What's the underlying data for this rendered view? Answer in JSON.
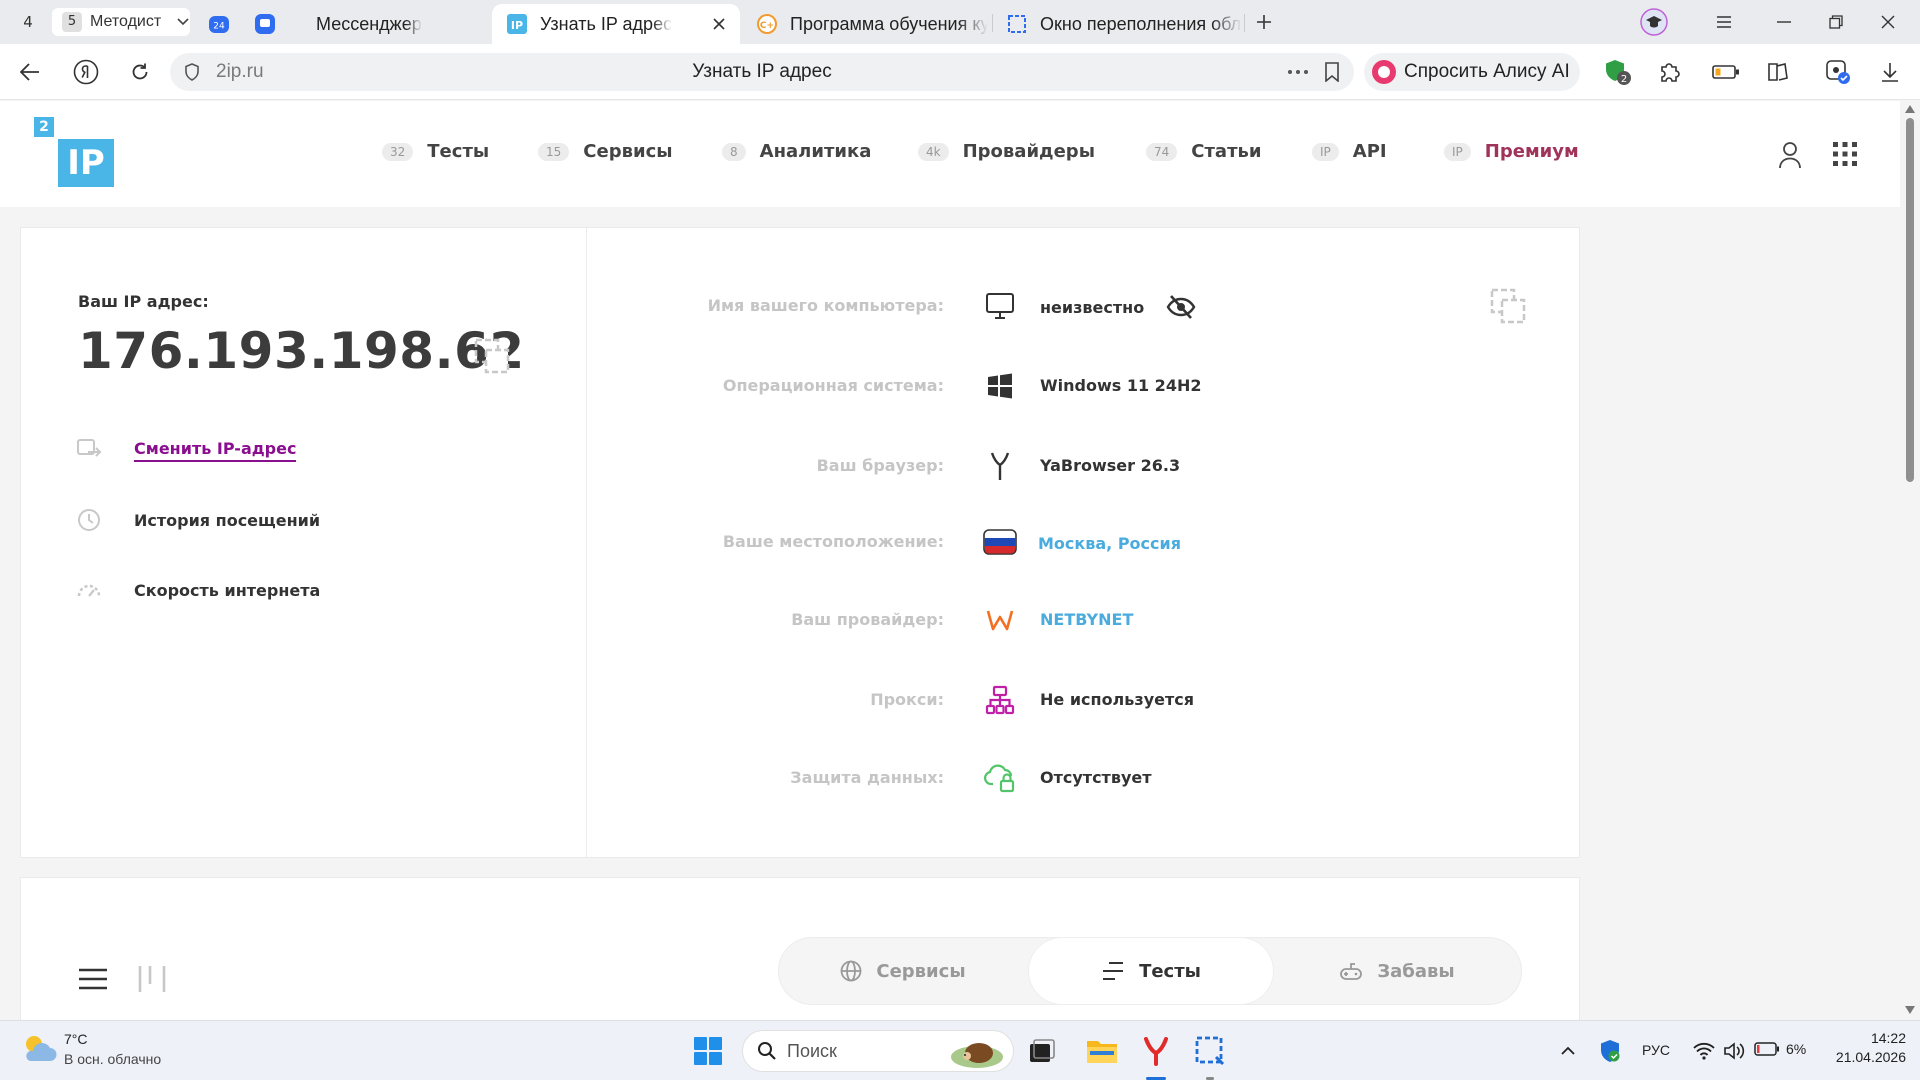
{
  "browser": {
    "tab_groups": [
      {
        "count": "4"
      },
      {
        "count": "5",
        "label": "Методист"
      }
    ],
    "tabs": [
      {
        "title": "Мессенджер"
      },
      {
        "title": "Узнать IP адрес"
      },
      {
        "title": "Программа обучения кур"
      },
      {
        "title": "Окно переполнения обла"
      }
    ],
    "url_domain": "2ip.ru",
    "page_title": "Узнать IP адрес",
    "alice_label": "Спросить Алису AI",
    "extension_badge": "2"
  },
  "site": {
    "logo_text": "IP",
    "logo_badge": "2",
    "menu": [
      {
        "badge": "32",
        "label": "Тесты"
      },
      {
        "badge": "15",
        "label": "Сервисы"
      },
      {
        "badge": "8",
        "label": "Аналитика"
      },
      {
        "badge": "4k",
        "label": "Провайдеры"
      },
      {
        "badge": "74",
        "label": "Статьи"
      },
      {
        "badge": "IP",
        "label": "API"
      },
      {
        "badge": "IP",
        "label": "Премиум"
      }
    ]
  },
  "ip_card": {
    "label": "Ваш IP адрес:",
    "ip": "176.193.198.62",
    "actions": [
      {
        "label": "Сменить IP-адрес"
      },
      {
        "label": "История посещений"
      },
      {
        "label": "Скорость интернета"
      }
    ],
    "details": [
      {
        "label": "Имя вашего компьютера:",
        "value": "неизвестно",
        "icon": "monitor-icon"
      },
      {
        "label": "Операционная система:",
        "value": "Windows 11 24H2",
        "icon": "windows-icon"
      },
      {
        "label": "Ваш браузер:",
        "value": "YaBrowser 26.3",
        "icon": "yandex-browser-icon"
      },
      {
        "label": "Ваше местоположение:",
        "value": "Москва, Россия",
        "icon": "russia-flag-icon"
      },
      {
        "label": "Ваш провайдер:",
        "value": "NETBYNET",
        "icon": "provider-logo-icon"
      },
      {
        "label": "Прокси:",
        "value": "Не используется",
        "icon": "proxy-network-icon"
      },
      {
        "label": "Защита данных:",
        "value": "Отсутствует",
        "icon": "cloud-lock-icon"
      }
    ]
  },
  "services_card": {
    "segments": [
      {
        "label": "Сервисы",
        "active": false
      },
      {
        "label": "Тесты",
        "active": true
      },
      {
        "label": "Забавы",
        "active": false
      }
    ]
  },
  "taskbar": {
    "weather_temp": "7°C",
    "weather_desc": "В осн. облачно",
    "search_placeholder": "Поиск",
    "language": "РУС",
    "battery": "6%",
    "time": "14:22",
    "date": "21.04.2026"
  },
  "colors": {
    "premium": "#a0335a",
    "link_purple": "#8a0f8f",
    "value_blue": "#4aabde",
    "logo_blue": "#4ab6e8"
  }
}
